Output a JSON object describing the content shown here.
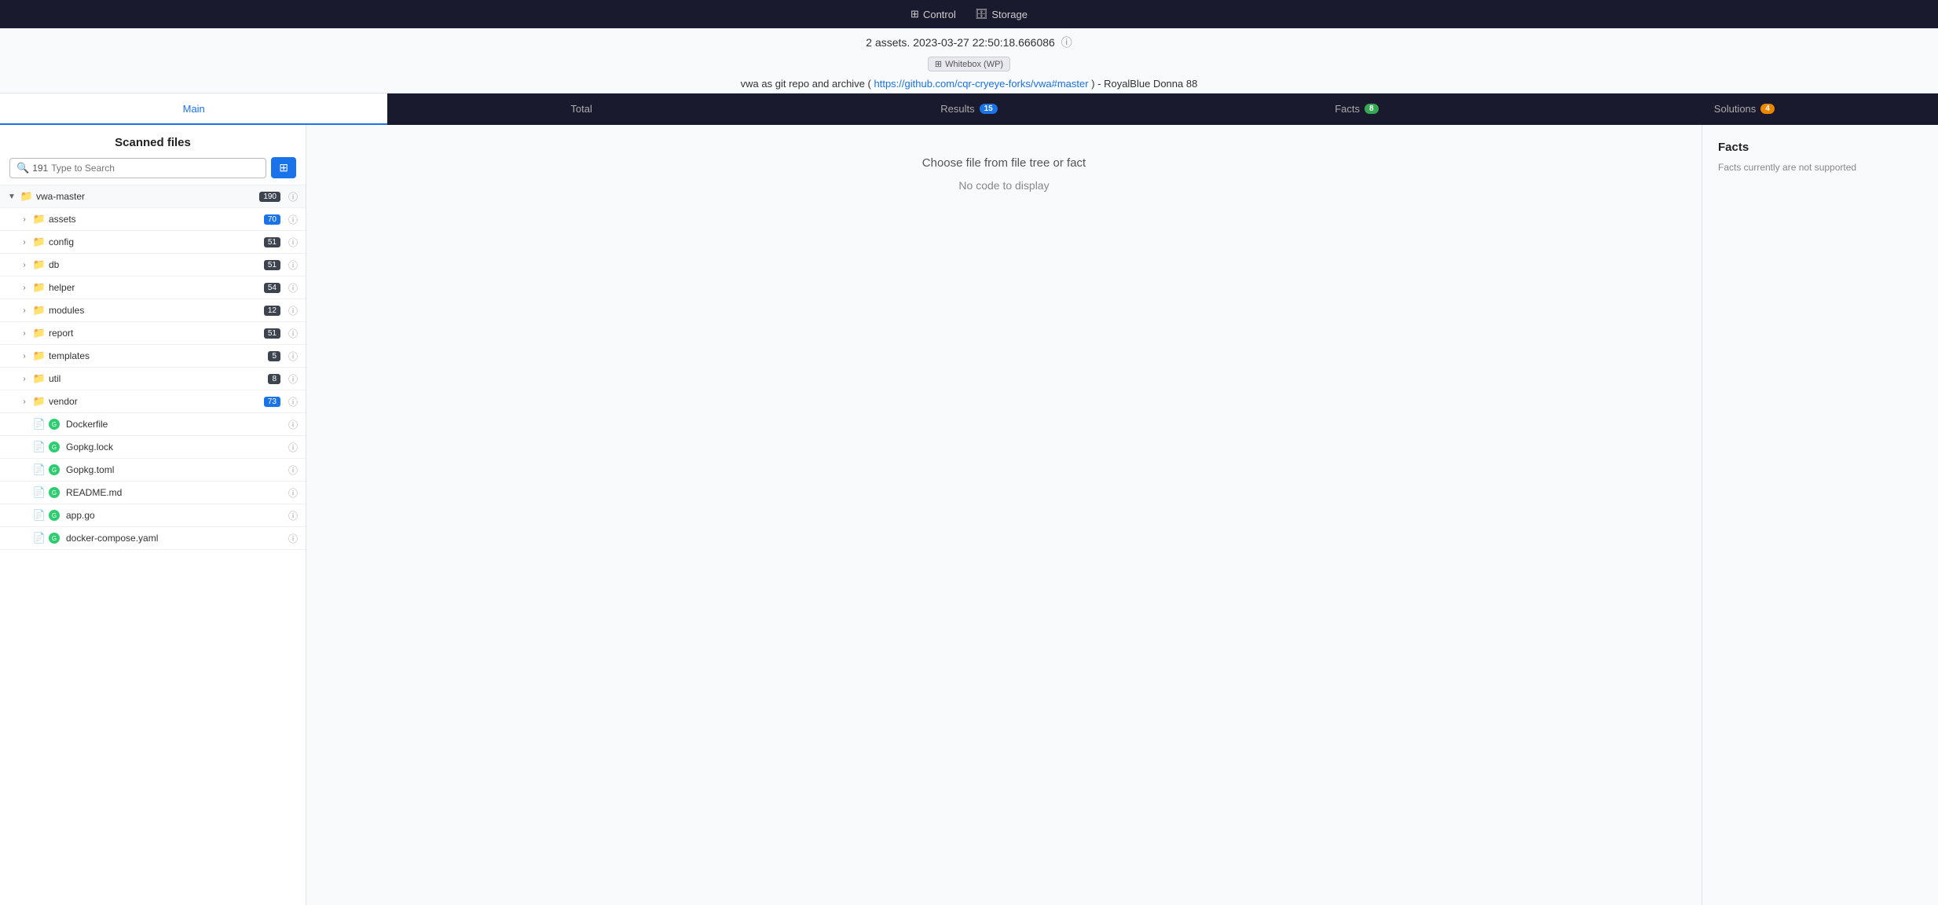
{
  "topNav": {
    "items": [
      {
        "id": "control",
        "label": "Control",
        "icon": "grid-icon"
      },
      {
        "id": "storage",
        "label": "Storage",
        "icon": "storage-icon"
      }
    ]
  },
  "infoBar": {
    "assetsText": "2 assets. 2023-03-27 22:50:18.666086",
    "helpIcon": "?",
    "whiteboxLabel": "Whitebox (WP)",
    "repoText": "vwa as git repo and archive ( https://github.com/cqr-cryeye-forks/vwa#master ) - RoyalBlue Donna 88",
    "repoUrl": "https://github.com/cqr-cryeye-forks/vwa#master"
  },
  "tabs": [
    {
      "id": "main",
      "label": "Main",
      "active": true,
      "badge": null
    },
    {
      "id": "total",
      "label": "Total",
      "active": false,
      "badge": null
    },
    {
      "id": "results",
      "label": "Results",
      "active": false,
      "badge": "15",
      "badgeColor": "blue"
    },
    {
      "id": "facts",
      "label": "Facts",
      "active": false,
      "badge": "8",
      "badgeColor": "green"
    },
    {
      "id": "solutions",
      "label": "Solutions",
      "active": false,
      "badge": "4",
      "badgeColor": "orange"
    }
  ],
  "leftPanel": {
    "title": "Scanned files",
    "searchCount": "191",
    "searchPlaceholder": "Type to Search",
    "filterButtonIcon": "filter-icon",
    "rootFolder": {
      "name": "vwa-master",
      "badge": "190",
      "badgeColor": "dark"
    },
    "folders": [
      {
        "name": "assets",
        "badge": "70",
        "badgeColor": "blue"
      },
      {
        "name": "config",
        "badge": "51",
        "badgeColor": "dark"
      },
      {
        "name": "db",
        "badge": "51",
        "badgeColor": "dark"
      },
      {
        "name": "helper",
        "badge": "54",
        "badgeColor": "dark"
      },
      {
        "name": "modules",
        "badge": "12",
        "badgeColor": "dark"
      },
      {
        "name": "report",
        "badge": "51",
        "badgeColor": "dark"
      },
      {
        "name": "templates",
        "badge": "5",
        "badgeColor": "dark"
      },
      {
        "name": "util",
        "badge": "8",
        "badgeColor": "dark"
      },
      {
        "name": "vendor",
        "badge": "73",
        "badgeColor": "blue"
      }
    ],
    "files": [
      {
        "name": "Dockerfile",
        "hasGreenDot": true
      },
      {
        "name": "Gopkg.lock",
        "hasGreenDot": true
      },
      {
        "name": "Gopkg.toml",
        "hasGreenDot": true
      },
      {
        "name": "README.md",
        "hasGreenDot": true
      },
      {
        "name": "app.go",
        "hasGreenDot": true
      },
      {
        "name": "docker-compose.yaml",
        "hasGreenDot": true
      }
    ]
  },
  "middlePanel": {
    "promptText": "Choose file from file tree or fact",
    "noCodeText": "No code to display"
  },
  "rightPanel": {
    "title": "Facts",
    "emptyText": "Facts currently are not supported"
  }
}
